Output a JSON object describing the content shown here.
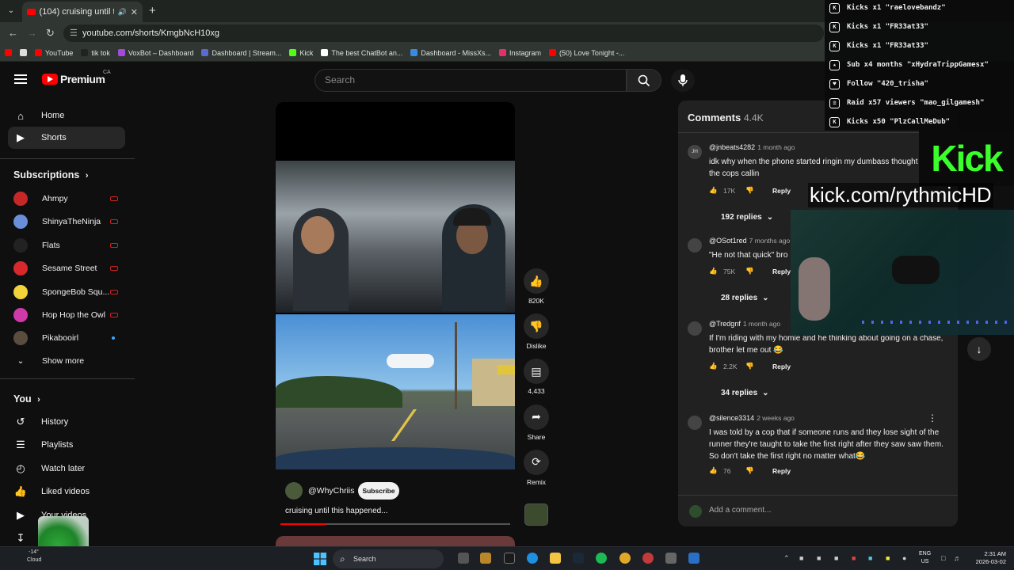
{
  "browser": {
    "tab_title": "(104) cruising until this hap",
    "new_tab": "+",
    "url": "youtube.com/shorts/KmgbNcH10xg",
    "bookmarks": [
      {
        "label": "",
        "color": "#ff0000"
      },
      {
        "label": "",
        "color": "#dddddd"
      },
      {
        "label": "YouTube",
        "color": "#ff0000"
      },
      {
        "label": "tik tok",
        "color": "#222222"
      },
      {
        "label": "VoxBot – Dashboard",
        "color": "#a24bd6"
      },
      {
        "label": "Dashboard | Stream...",
        "color": "#5a6acf"
      },
      {
        "label": "Kick",
        "color": "#53fc18"
      },
      {
        "label": "The best ChatBot an...",
        "color": "#ffffff"
      },
      {
        "label": "Dashboard - MissXs...",
        "color": "#3b8bdc"
      },
      {
        "label": "Instagram",
        "color": "#e1306c"
      },
      {
        "label": "(50) Love Tonight -...",
        "color": "#ff0000"
      }
    ]
  },
  "youtube": {
    "logo_text": "Premium",
    "region": "CA",
    "search_placeholder": "Search",
    "nav": [
      {
        "label": "Home",
        "icon": "home-icon"
      },
      {
        "label": "Shorts",
        "icon": "shorts-icon"
      }
    ],
    "subscriptions_heading": "Subscriptions",
    "subscriptions": [
      {
        "label": "Ahmpy",
        "color": "#c62828",
        "badge": "live"
      },
      {
        "label": "ShinyaTheNinja",
        "color": "#6a8fd8",
        "badge": "live"
      },
      {
        "label": "Flats",
        "color": "#222222",
        "badge": "live"
      },
      {
        "label": "Sesame Street",
        "color": "#d8282c",
        "badge": "live"
      },
      {
        "label": "SpongeBob Squ...",
        "color": "#f3d33a",
        "badge": "live"
      },
      {
        "label": "Hop Hop the Owl",
        "color": "#cf3aa8",
        "badge": "live"
      },
      {
        "label": "Pikabooirl",
        "color": "#5b4d3e",
        "badge": "dot"
      }
    ],
    "show_more": "Show more",
    "you_heading": "You",
    "you_items": [
      {
        "label": "History",
        "icon": "history-icon"
      },
      {
        "label": "Playlists",
        "icon": "playlists-icon"
      },
      {
        "label": "Watch later",
        "icon": "watch-later-icon"
      },
      {
        "label": "Liked videos",
        "icon": "liked-videos-icon"
      },
      {
        "label": "Your videos",
        "icon": "your-videos-icon"
      },
      {
        "label": "",
        "icon": "downloads-icon"
      }
    ]
  },
  "short": {
    "channel": "@WhyChriis",
    "subscribe": "Subscribe",
    "title": "cruising until this happened...",
    "progress": 0.2,
    "actions": [
      {
        "icon": "like-icon",
        "label": "820K"
      },
      {
        "icon": "dislike-icon",
        "label": "Dislike"
      },
      {
        "icon": "comment-icon",
        "label": "4,433"
      },
      {
        "icon": "share-icon",
        "label": "Share"
      },
      {
        "icon": "remix-icon",
        "label": "Remix"
      }
    ]
  },
  "comments": {
    "heading": "Comments",
    "count": "4.4K",
    "input_placeholder": "Add a comment...",
    "items": [
      {
        "avatar": "JH",
        "author": "@jnbeats4282",
        "time": "1 month ago",
        "text": "idk why when the phone started ringin my dumbass thought it was the cops callin",
        "likes": "17K",
        "reply": "Reply",
        "replies": "192 replies"
      },
      {
        "avatar": "",
        "author": "@OSot1red",
        "time": "7 months ago",
        "text": "\"He not that quick\" bro",
        "likes": "75K",
        "reply": "Reply",
        "replies": "28 replies"
      },
      {
        "avatar": "",
        "author": "@Tredgnf",
        "time": "1 month ago",
        "text": "If I'm riding with my homie and he thinking about going on a chase, brother let me out 😂",
        "likes": "2.2K",
        "reply": "Reply",
        "replies": "34 replies"
      },
      {
        "avatar": "",
        "author": "@silence3314",
        "time": "2 weeks ago",
        "text": "I was told by a cop that if someone runs and they lose sight of the runner they're taught to take the first right after they saw saw them. So don't take the first right no matter what😂",
        "likes": "76",
        "reply": "Reply",
        "replies": ""
      }
    ]
  },
  "overlay": {
    "events": [
      {
        "icon": "kick-icon",
        "text": "Kicks x1 \"raelovebandz\""
      },
      {
        "icon": "kick-icon",
        "text": "Kicks x1 \"FR33at33\""
      },
      {
        "icon": "kick-icon",
        "text": "Kicks x1 \"FR33at33\""
      },
      {
        "icon": "star-icon",
        "text": "Sub x4 months \"xHydraTrippGamesx\""
      },
      {
        "icon": "heart-icon",
        "text": "Follow \"420_trisha\""
      },
      {
        "icon": "raid-icon",
        "text": "Raid x57 viewers \"mao_gilgamesh\""
      },
      {
        "icon": "kick-icon",
        "text": "Kicks x50 \"PlzCallMeDub\""
      }
    ],
    "kick_logo": "Kick",
    "kick_url": "kick.com/rythmicHD"
  },
  "taskbar": {
    "weather_temp": "-14°",
    "weather_text": "Cloud",
    "search": "Search",
    "lang_1": "ENG",
    "lang_2": "US",
    "time": "2:31 AM",
    "date": "2026-03-02"
  }
}
